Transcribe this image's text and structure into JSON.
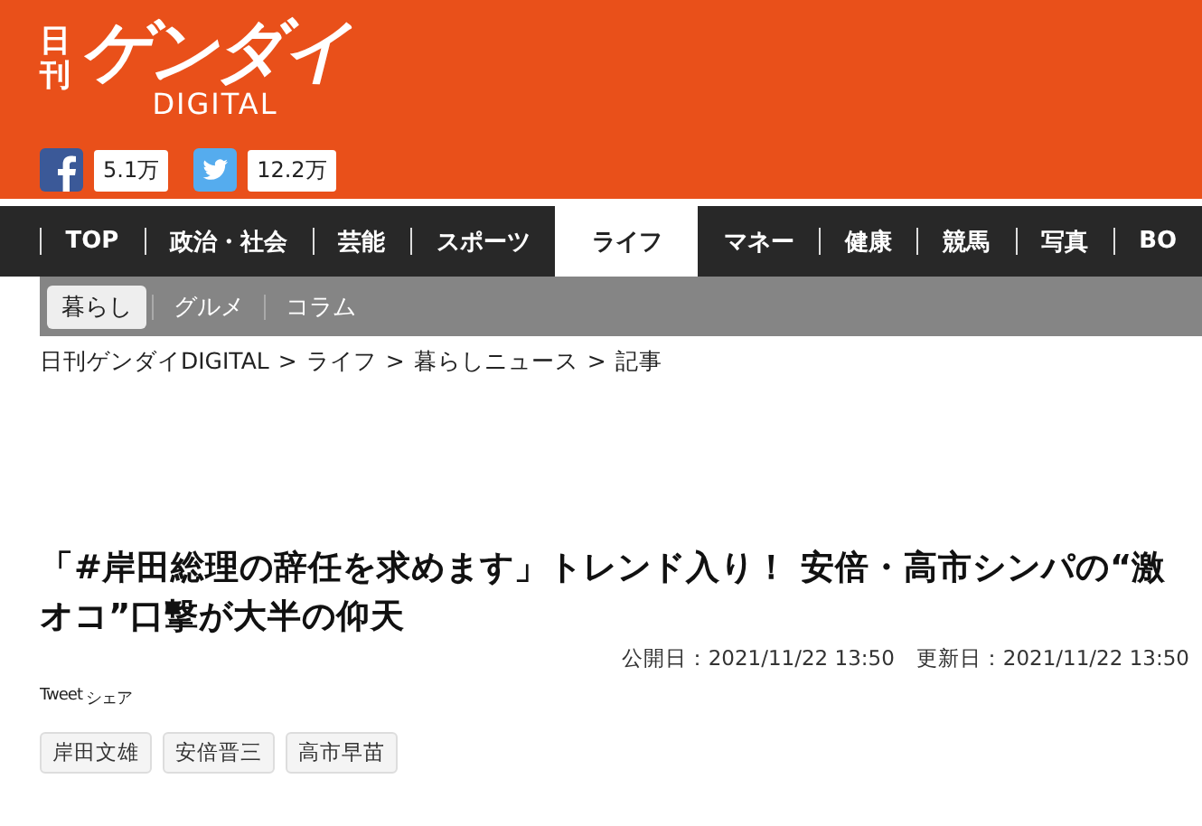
{
  "logo": {
    "small": "日刊",
    "main": "ゲンダイ",
    "sub": "DIGITAL"
  },
  "social": [
    {
      "kind": "facebook",
      "count": "5.1万"
    },
    {
      "kind": "twitter",
      "count": "12.2万"
    }
  ],
  "nav": [
    {
      "label": "TOP",
      "selected": false
    },
    {
      "label": "政治・社会",
      "selected": false
    },
    {
      "label": "芸能",
      "selected": false
    },
    {
      "label": "スポーツ",
      "selected": false
    },
    {
      "label": "ライフ",
      "selected": true
    },
    {
      "label": "マネー",
      "selected": false
    },
    {
      "label": "健康",
      "selected": false
    },
    {
      "label": "競馬",
      "selected": false
    },
    {
      "label": "写真",
      "selected": false
    },
    {
      "label": "BO",
      "selected": false
    }
  ],
  "subnav": [
    {
      "label": "暮らし",
      "selected": true
    },
    {
      "label": "グルメ",
      "selected": false
    },
    {
      "label": "コラム",
      "selected": false
    }
  ],
  "breadcrumb": [
    "日刊ゲンダイDIGITAL",
    "ライフ",
    "暮らしニュース",
    "記事"
  ],
  "breadcrumb_separator": ">",
  "article": {
    "title": "「#岸田総理の辞任を求めます」トレンド入り！ 安倍・高市シンパの“激オコ”口撃が大半の仰天",
    "published": "公開日：2021/11/22 13:50",
    "updated": "更新日：2021/11/22 13:50",
    "share": [
      "Tweet",
      "シェア"
    ],
    "tags": [
      "岸田文雄",
      "安倍晋三",
      "高市早苗"
    ]
  }
}
